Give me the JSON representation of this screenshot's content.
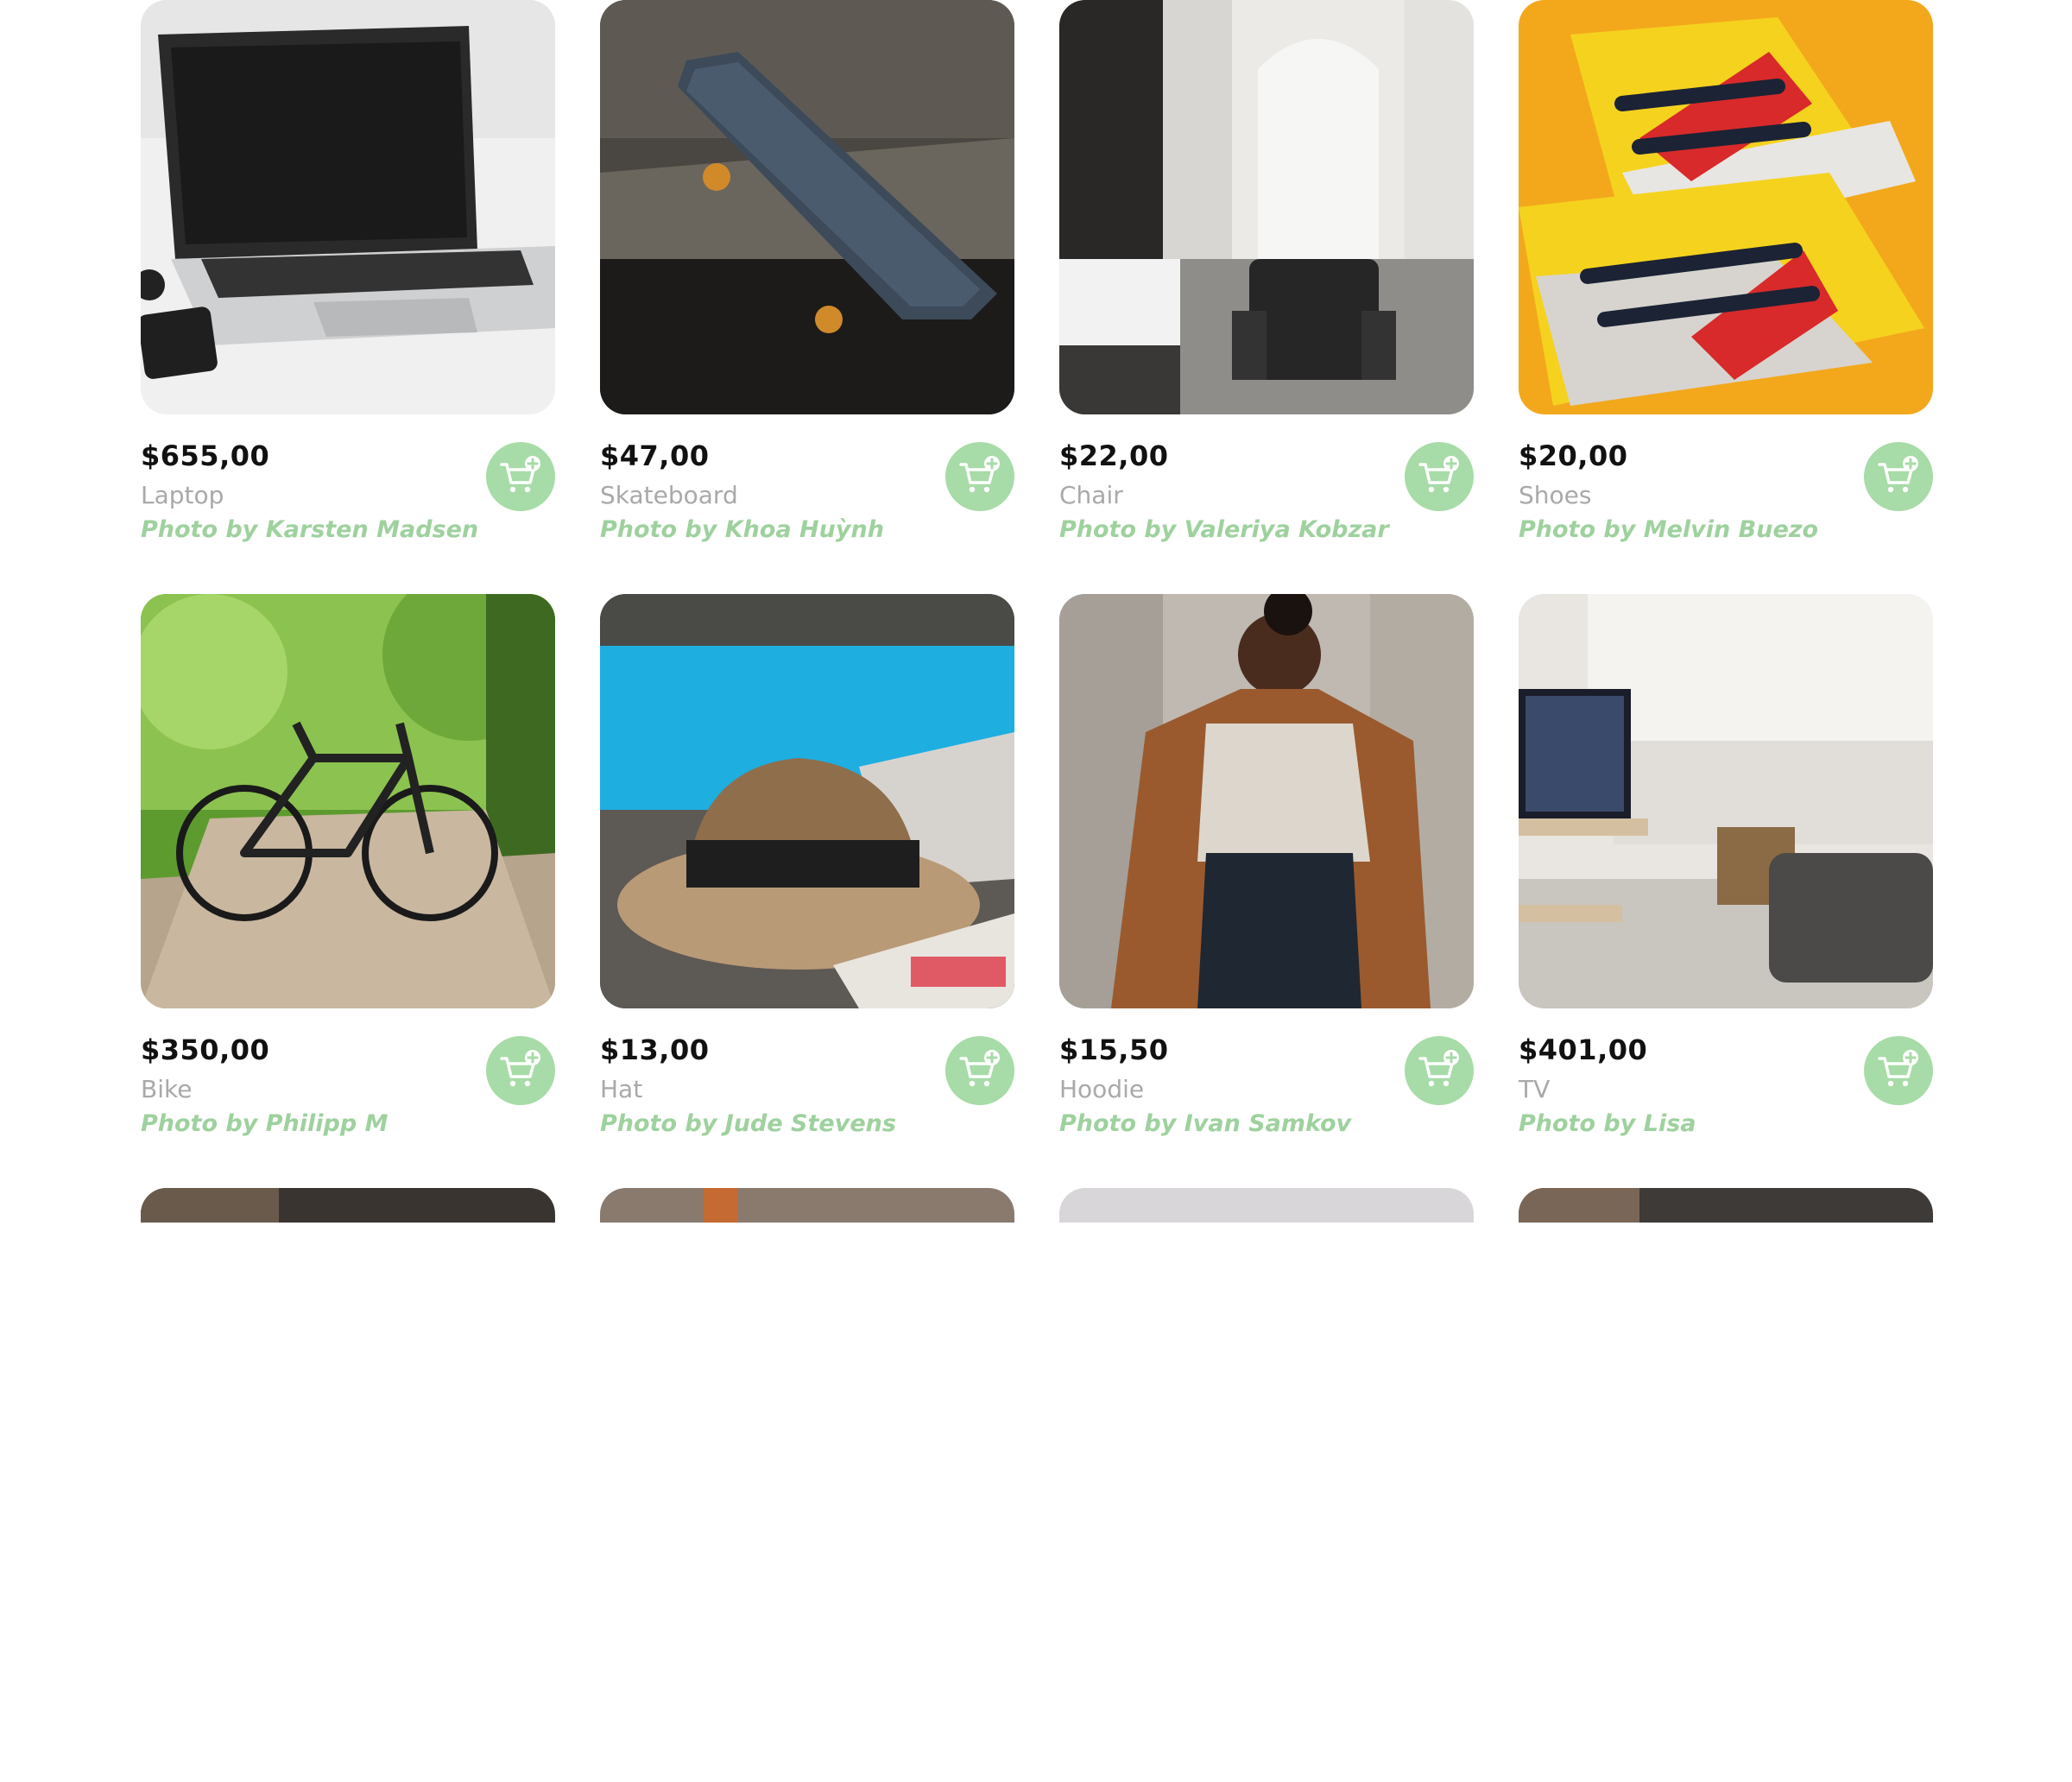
{
  "products": [
    {
      "price": "$655,00",
      "name": "Laptop",
      "credit": "Photo by Karsten Madsen",
      "icon": "laptop-photo"
    },
    {
      "price": "$47,00",
      "name": "Skateboard",
      "credit": "Photo by Khoa Huỳnh",
      "icon": "skateboard-photo"
    },
    {
      "price": "$22,00",
      "name": "Chair",
      "credit": "Photo by Valeriya Kobzar",
      "icon": "chair-photo"
    },
    {
      "price": "$20,00",
      "name": "Shoes",
      "credit": "Photo by Melvin Buezo",
      "icon": "shoes-photo"
    },
    {
      "price": "$350,00",
      "name": "Bike",
      "credit": "Photo by Philipp M",
      "icon": "bike-photo"
    },
    {
      "price": "$13,00",
      "name": "Hat",
      "credit": "Photo by Jude Stevens",
      "icon": "hat-photo"
    },
    {
      "price": "$15,50",
      "name": "Hoodie",
      "credit": "Photo by Ivan Samkov",
      "icon": "hoodie-photo"
    },
    {
      "price": "$401,00",
      "name": "TV",
      "credit": "Photo by Lisa",
      "icon": "tv-photo"
    }
  ],
  "cart_button_icon": "add-to-cart-icon",
  "colors": {
    "accent": "#a7dba7",
    "credit_text": "#9ed19e",
    "name_text": "#a9a9a9",
    "price_text": "#111111"
  }
}
